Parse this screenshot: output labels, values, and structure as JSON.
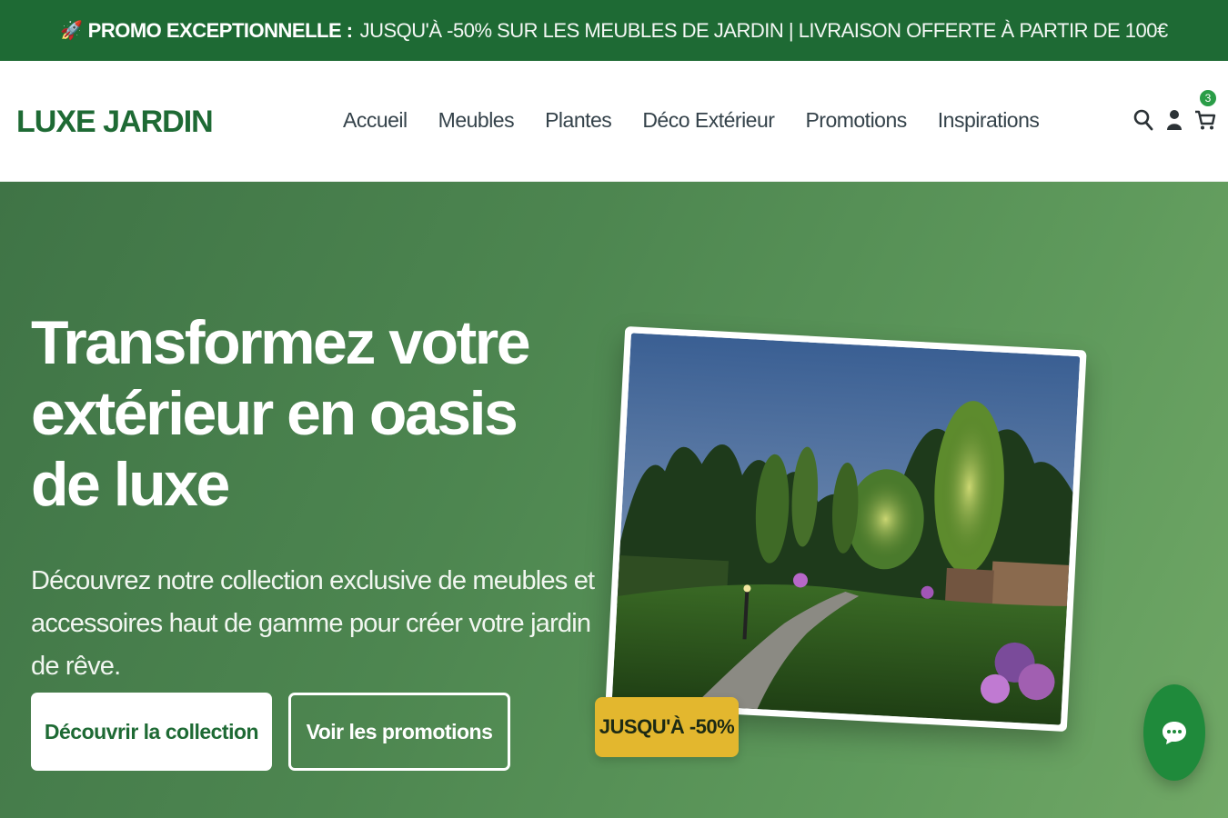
{
  "promo": {
    "icon": "rocket-icon",
    "strong": "PROMO EXCEPTIONNELLE :",
    "text": "JUSQU'À -50% SUR LES MEUBLES DE JARDIN | LIVRAISON OFFERTE À PARTIR DE 100€"
  },
  "header": {
    "logo": "LUXE JARDIN",
    "nav": [
      "Accueil",
      "Meubles",
      "Plantes",
      "Déco Extérieur",
      "Promotions",
      "Inspirations"
    ],
    "icons": [
      "search-icon",
      "user-icon",
      "cart-icon"
    ],
    "cart_count": "3"
  },
  "hero": {
    "title": "Transformez votre extérieur en oasis de luxe",
    "subtitle": "Découvrez notre collection exclusive de meubles et accessoires haut de gamme pour créer votre jardin de rêve.",
    "primary_button": "Découvrir la collection",
    "secondary_button": "Voir les promotions",
    "badge": "JUSQU'À -50%"
  },
  "colors": {
    "brand_green": "#1e6a34",
    "hero_green": "#4d8650",
    "badge_yellow": "#e3b72e",
    "chat_green": "#1f8a3b"
  },
  "chat": {
    "icon": "chat-bubble-icon"
  }
}
